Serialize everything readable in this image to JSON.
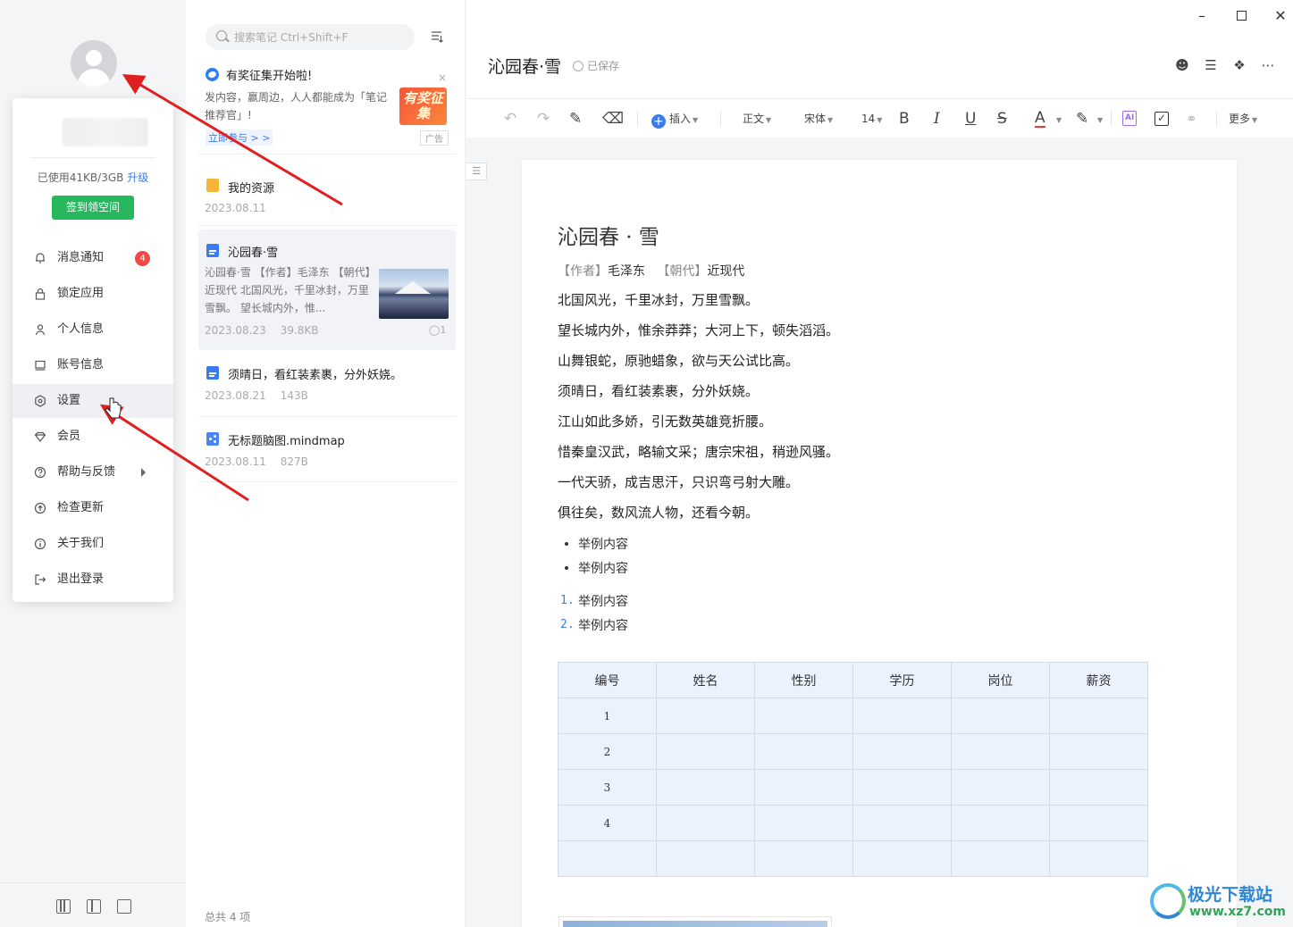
{
  "sidebar": {
    "popup": {
      "storage_text": "已使用41KB/3GB",
      "upgrade_label": "升级",
      "sign_button": "签到领空间",
      "items": [
        {
          "label": "消息通知",
          "icon": "bell-icon",
          "badge": "4"
        },
        {
          "label": "锁定应用",
          "icon": "lock-icon"
        },
        {
          "label": "个人信息",
          "icon": "person-icon"
        },
        {
          "label": "账号信息",
          "icon": "monitor-icon"
        },
        {
          "label": "设置",
          "icon": "gear-icon"
        },
        {
          "label": "会员",
          "icon": "gem-icon"
        },
        {
          "label": "帮助与反馈",
          "icon": "help-icon"
        },
        {
          "label": "检查更新",
          "icon": "update-icon"
        },
        {
          "label": "关于我们",
          "icon": "info-icon"
        },
        {
          "label": "退出登录",
          "icon": "logout-icon"
        }
      ]
    }
  },
  "notelist": {
    "search_placeholder": "搜索笔记 Ctrl+Shift+F",
    "promo": {
      "title": "有奖征集开始啦!",
      "desc": "发内容，赢周边，人人都能成为「笔记推荐官」!",
      "link": "立即参与 > >",
      "image_text": "有奖征集",
      "ad_label": "广告",
      "close": "×"
    },
    "notes": [
      {
        "title": "我的资源",
        "date": "2023.08.11",
        "size": "",
        "type": "folder"
      },
      {
        "title": "沁园春·雪",
        "date": "2023.08.23",
        "size": "39.8KB",
        "type": "doc",
        "snippet": "沁园春·雪 【作者】毛泽东 【朝代】近现代 北国风光，千里冰封，万里雪飘。 望长城内外，惟...",
        "attachments": "1"
      },
      {
        "title": "须晴日，看红装素裹，分外妖娆。",
        "date": "2023.08.21",
        "size": "143B",
        "type": "doc"
      },
      {
        "title": "无标题脑图.mindmap",
        "date": "2023.08.11",
        "size": "827B",
        "type": "mindmap"
      }
    ],
    "total": "总共 4 项"
  },
  "editor": {
    "title": "沁园春·雪",
    "saved": "已保存",
    "toolbar": {
      "insert": "插入",
      "style": "正文",
      "font": "宋体",
      "size": "14",
      "more": "更多",
      "bold": "B",
      "italic": "I",
      "underline": "U",
      "strike": "S",
      "font_color": "A"
    },
    "accent_color": "#3a7cf0",
    "doc": {
      "heading": "沁园春 · 雪",
      "author_label": "【作者】",
      "author": "毛泽东",
      "era_label": "【朝代】",
      "era": "近现代",
      "lines": [
        "北国风光，千里冰封，万里雪飘。",
        "望长城内外，惟余莽莽；大河上下，顿失滔滔。",
        "山舞银蛇，原驰蜡象，欲与天公试比高。",
        "须晴日，看红装素裹，分外妖娆。",
        "江山如此多娇，引无数英雄竞折腰。",
        "惜秦皇汉武，略输文采；唐宗宋祖，稍逊风骚。",
        "一代天骄，成吉思汗，只识弯弓射大雕。",
        "俱往矣，数风流人物，还看今朝。"
      ],
      "bullets": [
        "举例内容",
        "举例内容"
      ],
      "ordered": [
        "举例内容",
        "举例内容"
      ],
      "table": {
        "headers": [
          "编号",
          "姓名",
          "性别",
          "学历",
          "岗位",
          "薪资"
        ],
        "rows": [
          [
            "1",
            "",
            "",
            "",
            "",
            ""
          ],
          [
            "2",
            "",
            "",
            "",
            "",
            ""
          ],
          [
            "3",
            "",
            "",
            "",
            "",
            ""
          ],
          [
            "4",
            "",
            "",
            "",
            "",
            ""
          ],
          [
            "",
            "",
            "",
            "",
            "",
            ""
          ]
        ]
      }
    }
  },
  "watermark": {
    "text": "极光下载站",
    "url": "www.xz7.com"
  }
}
